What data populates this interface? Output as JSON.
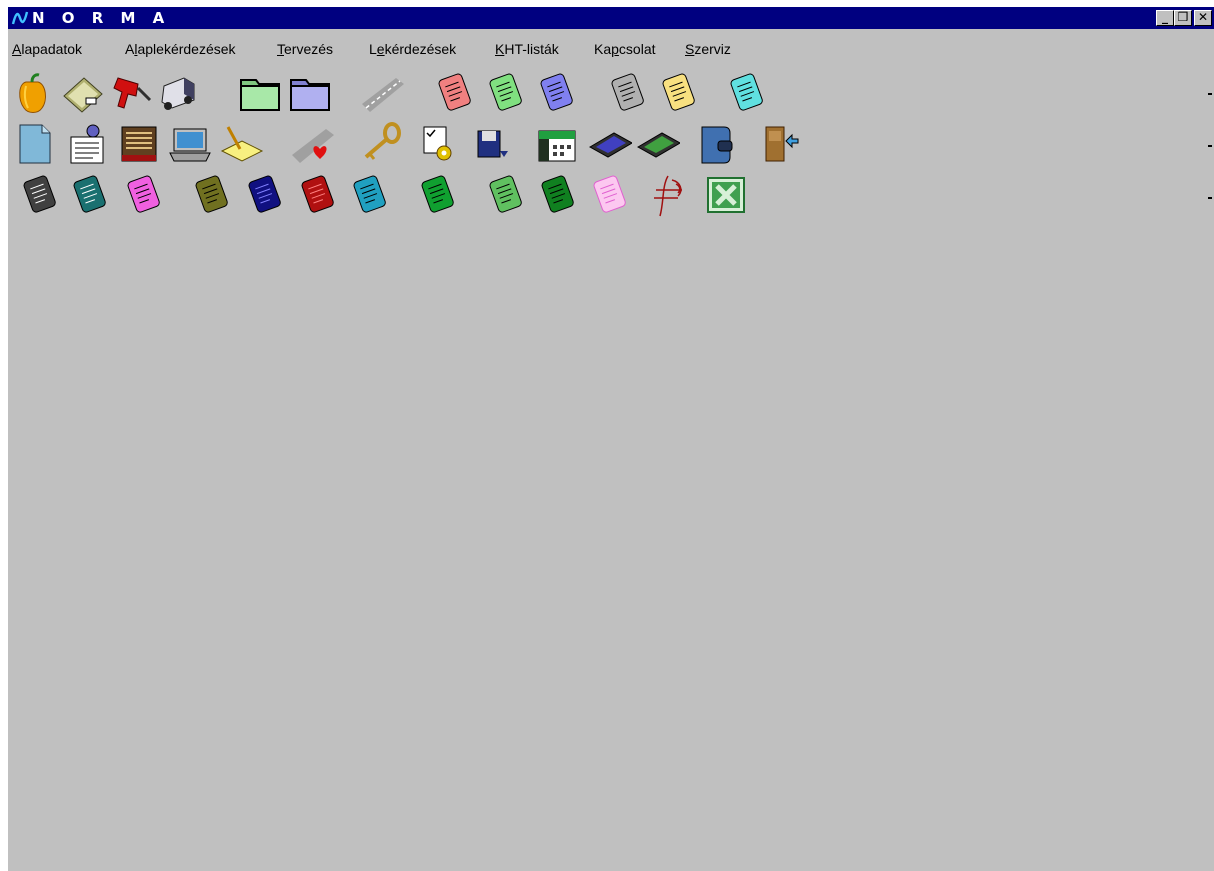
{
  "window": {
    "title": "N O R M A",
    "controls": {
      "minimize": "_",
      "restore": "❒",
      "close": "✕"
    }
  },
  "menu": [
    {
      "before": "",
      "acc": "A",
      "after": "lapadatok"
    },
    {
      "before": "A",
      "acc": "l",
      "after": "aplekérdezések"
    },
    {
      "before": "",
      "acc": "T",
      "after": "ervezés"
    },
    {
      "before": "L",
      "acc": "e",
      "after": "kérdezések"
    },
    {
      "before": "",
      "acc": "K",
      "after": "HT-listák"
    },
    {
      "before": "Ka",
      "acc": "p",
      "after": "csolat"
    },
    {
      "before": "",
      "acc": "S",
      "after": "zerviz"
    }
  ],
  "toolbar": {
    "row1": [
      {
        "icon": "pepper-icon"
      },
      {
        "icon": "scanner-icon"
      },
      {
        "icon": "drill-icon"
      },
      {
        "icon": "truck-icon"
      },
      {
        "icon": "folder-icon",
        "color": "#7fc77f"
      },
      {
        "icon": "folder-icon",
        "color": "#8080d0"
      },
      {
        "icon": "road-icon"
      },
      {
        "icon": "document-icon",
        "color": "#f08080"
      },
      {
        "icon": "document-icon",
        "color": "#80e080"
      },
      {
        "icon": "document-icon",
        "color": "#8080f0"
      },
      {
        "icon": "document-icon",
        "color": "#b0b0b0"
      },
      {
        "icon": "document-icon",
        "color": "#f8e080"
      },
      {
        "icon": "document-icon",
        "color": "#60e0e0"
      }
    ],
    "row2": [
      {
        "icon": "blank-page-icon"
      },
      {
        "icon": "notice-board-icon"
      },
      {
        "icon": "ledger-icon"
      },
      {
        "icon": "laptop-icon"
      },
      {
        "icon": "pencil-note-icon"
      },
      {
        "icon": "road-heart-icon"
      },
      {
        "icon": "key-icon"
      },
      {
        "icon": "settings-form-icon"
      },
      {
        "icon": "floppy-icon"
      },
      {
        "icon": "calendar-icon"
      },
      {
        "icon": "calculator-icon",
        "color": "#4040c0"
      },
      {
        "icon": "calculator-icon",
        "color": "#40a040"
      },
      {
        "icon": "wallet-icon"
      },
      {
        "icon": "exit-door-icon"
      }
    ],
    "row3": [
      {
        "icon": "document-icon",
        "color": "#404040"
      },
      {
        "icon": "document-icon",
        "color": "#1a7070"
      },
      {
        "icon": "document-icon",
        "color": "#f060e0"
      },
      {
        "icon": "document-icon",
        "color": "#707020"
      },
      {
        "icon": "document-icon",
        "color": "#101080"
      },
      {
        "icon": "document-icon",
        "color": "#b01010"
      },
      {
        "icon": "document-icon",
        "color": "#20a0c0"
      },
      {
        "icon": "document-icon",
        "color": "#10a030"
      },
      {
        "icon": "document-icon",
        "color": "#60c060"
      },
      {
        "icon": "document-icon",
        "color": "#108020"
      },
      {
        "icon": "document-icon",
        "color": "#fcc8f0"
      },
      {
        "icon": "map-route-icon"
      },
      {
        "icon": "excel-icon"
      }
    ]
  }
}
